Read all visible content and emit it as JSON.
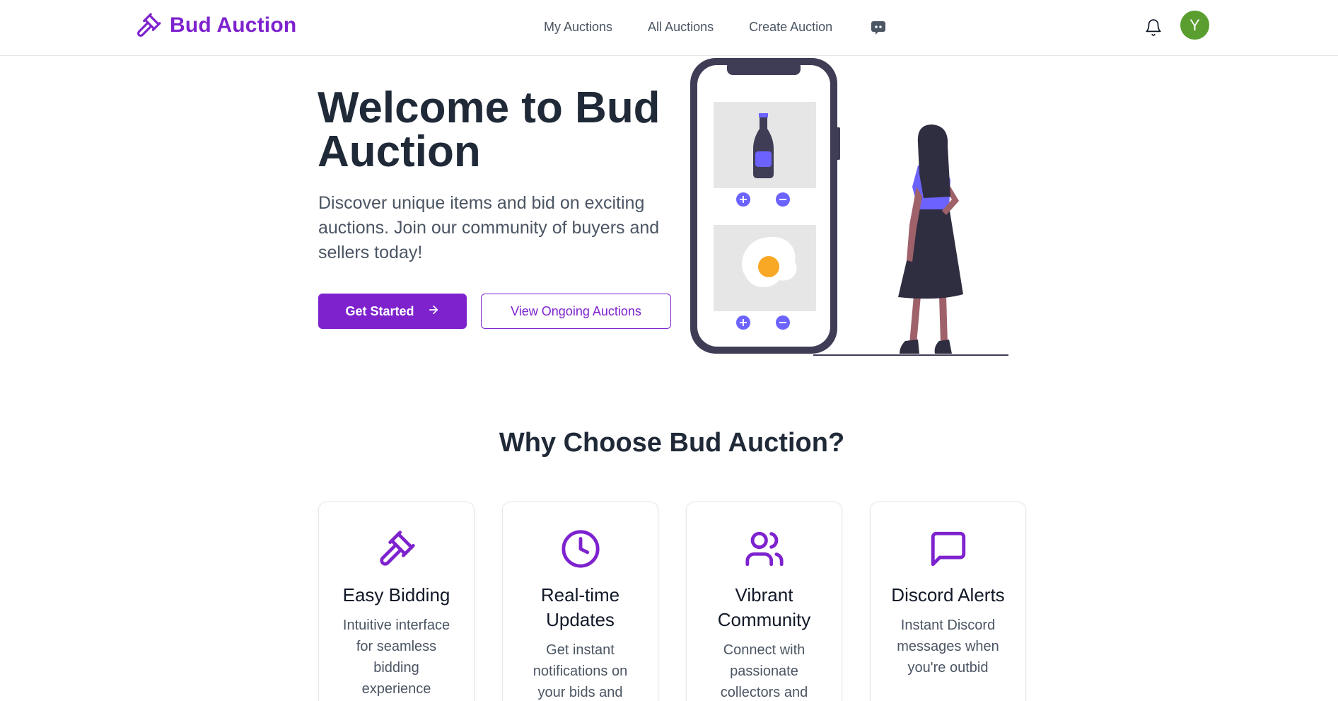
{
  "brand": {
    "name": "Bud Auction",
    "color": "#7e22ce"
  },
  "nav": {
    "links": [
      "My Auctions",
      "All Auctions",
      "Create Auction"
    ],
    "discord_icon": "discord-icon",
    "bell_icon": "bell-icon",
    "avatar_initial": "Y"
  },
  "hero": {
    "title": "Welcome to Bud Auction",
    "subtitle": "Discover unique items and bid on exciting auctions. Join our community of buyers and sellers today!",
    "primary_button": "Get Started",
    "secondary_button": "View Ongoing Auctions"
  },
  "features": {
    "title": "Why Choose Bud Auction?",
    "cards": [
      {
        "icon": "gavel-icon",
        "title": "Easy Bidding",
        "desc": "Intuitive interface for seamless bidding experience"
      },
      {
        "icon": "clock-icon",
        "title": "Real-time Updates",
        "desc": "Get instant notifications on your bids and"
      },
      {
        "icon": "users-icon",
        "title": "Vibrant Community",
        "desc": "Connect with passionate collectors and"
      },
      {
        "icon": "message-icon",
        "title": "Discord Alerts",
        "desc": "Instant Discord messages when you're outbid"
      }
    ]
  }
}
